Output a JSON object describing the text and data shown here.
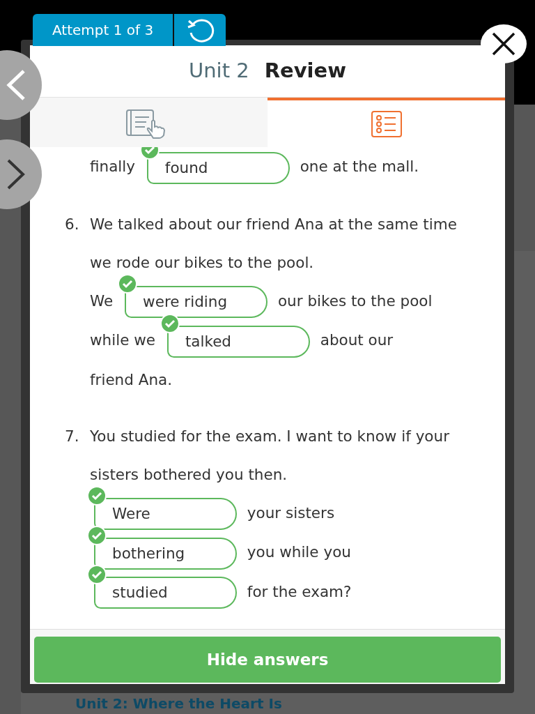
{
  "attempt": {
    "label": "Attempt 1 of 3"
  },
  "background": {
    "heading": "Unit 2: Where the Heart Is"
  },
  "dialog": {
    "unit": "Unit 2",
    "title": "Review"
  },
  "tabs": [
    {
      "selected": false
    },
    {
      "selected": true
    }
  ],
  "questions": [
    {
      "answer_lines": [
        [
          {
            "kind": "text",
            "text": "finally"
          },
          {
            "kind": "blank",
            "text": "found",
            "correct": true
          },
          {
            "kind": "text",
            "text": "one at the mall."
          }
        ]
      ]
    },
    {
      "number": "6.",
      "prompt": "We talked about our friend Ana at the same time we rode our bikes to the pool.",
      "answer_lines": [
        [
          {
            "kind": "text",
            "text": "We"
          },
          {
            "kind": "blank",
            "text": "were riding",
            "correct": true
          },
          {
            "kind": "text",
            "text": "our bikes to the pool"
          }
        ],
        [
          {
            "kind": "text",
            "text": "while we"
          },
          {
            "kind": "blank",
            "text": "talked",
            "correct": true
          },
          {
            "kind": "text",
            "text": "about our"
          }
        ],
        [
          {
            "kind": "text",
            "text": "friend Ana."
          }
        ]
      ]
    },
    {
      "number": "7.",
      "prompt": "You studied for the exam. I want to know if your sisters bothered you then.",
      "answer_lines": [
        [
          {
            "kind": "blank",
            "text": "Were",
            "correct": true
          },
          {
            "kind": "text",
            "text": "your sisters"
          }
        ],
        [
          {
            "kind": "blank",
            "text": "bothering",
            "correct": true
          },
          {
            "kind": "text",
            "text": "you while you"
          }
        ],
        [
          {
            "kind": "blank",
            "text": "studied",
            "correct": true
          },
          {
            "kind": "text",
            "text": "for the exam?"
          }
        ]
      ]
    }
  ],
  "footer_button": "Hide answers"
}
